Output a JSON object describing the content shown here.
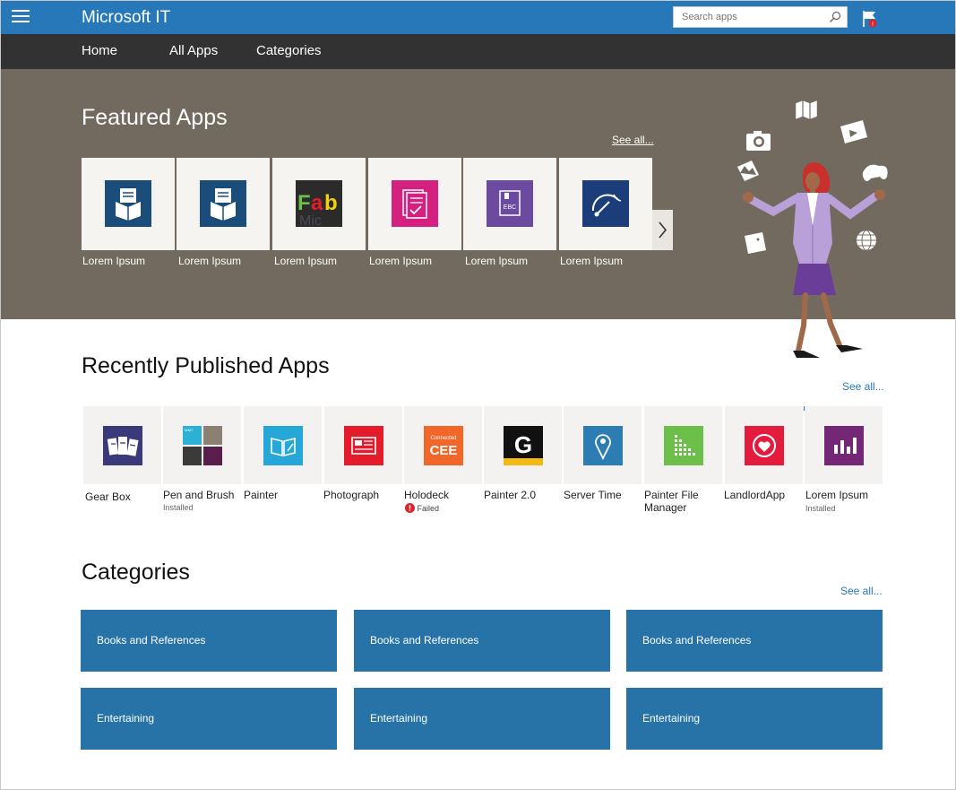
{
  "header": {
    "brand": "Microsoft IT",
    "search_placeholder": "Search apps"
  },
  "nav": {
    "items": [
      "Home",
      "All Apps",
      "Categories"
    ]
  },
  "featured": {
    "title": "Featured Apps",
    "see_all": "See all...",
    "apps": [
      {
        "label": "Lorem Ipsum",
        "icon": "box-document-icon",
        "color": "#1a4d7a"
      },
      {
        "label": "Lorem Ipsum",
        "icon": "box-document-icon",
        "color": "#1a4d7a"
      },
      {
        "label": "Lorem Ipsum",
        "icon": "fab-icon",
        "color": "#2b2b2b"
      },
      {
        "label": "Lorem Ipsum",
        "icon": "checklist-document-icon",
        "color": "#d4217f"
      },
      {
        "label": "Lorem Ipsum",
        "icon": "ebc-book-icon",
        "color": "#6b4aa0"
      },
      {
        "label": "Lorem Ipsum",
        "icon": "gauge-icon",
        "color": "#1b3d7a"
      }
    ]
  },
  "recent": {
    "title": "Recently Published Apps",
    "see_all": "See all...",
    "apps": [
      {
        "name": "Gear Box",
        "status": "",
        "icon": "gear-box-icon",
        "color": "#3a3a7a"
      },
      {
        "name": "Pen and Brush",
        "status": "Installed",
        "icon": "pen-brush-icon",
        "color": "#2bb0d6"
      },
      {
        "name": "Painter",
        "status": "",
        "icon": "open-book-icon",
        "color": "#27a7d8"
      },
      {
        "name": "Photograph",
        "status": "",
        "icon": "photograph-icon",
        "color": "#e31b2b"
      },
      {
        "name": "Holodeck",
        "status": "Failed",
        "icon": "connected-cee-icon",
        "color": "#f2662a"
      },
      {
        "name": "Painter 2.0",
        "status": "",
        "icon": "letter-g-icon",
        "color": "#111111"
      },
      {
        "name": "Server Time",
        "status": "",
        "icon": "map-pin-icon",
        "color": "#2b7db3"
      },
      {
        "name": "Painter File Manager",
        "status": "",
        "icon": "grid-icon",
        "color": "#6cc04a"
      },
      {
        "name": "LandlordApp",
        "status": "",
        "icon": "heart-icon",
        "color": "#e31b3d"
      },
      {
        "name": "Lorem Ipsum",
        "status": "Installed",
        "icon": "bar-chart-icon",
        "color": "#742774"
      }
    ]
  },
  "categories": {
    "title": "Categories",
    "see_all": "See all...",
    "items": [
      "Books and References",
      "Books and References",
      "Books and References",
      "Entertaining",
      "Entertaining",
      "Entertaining"
    ]
  }
}
